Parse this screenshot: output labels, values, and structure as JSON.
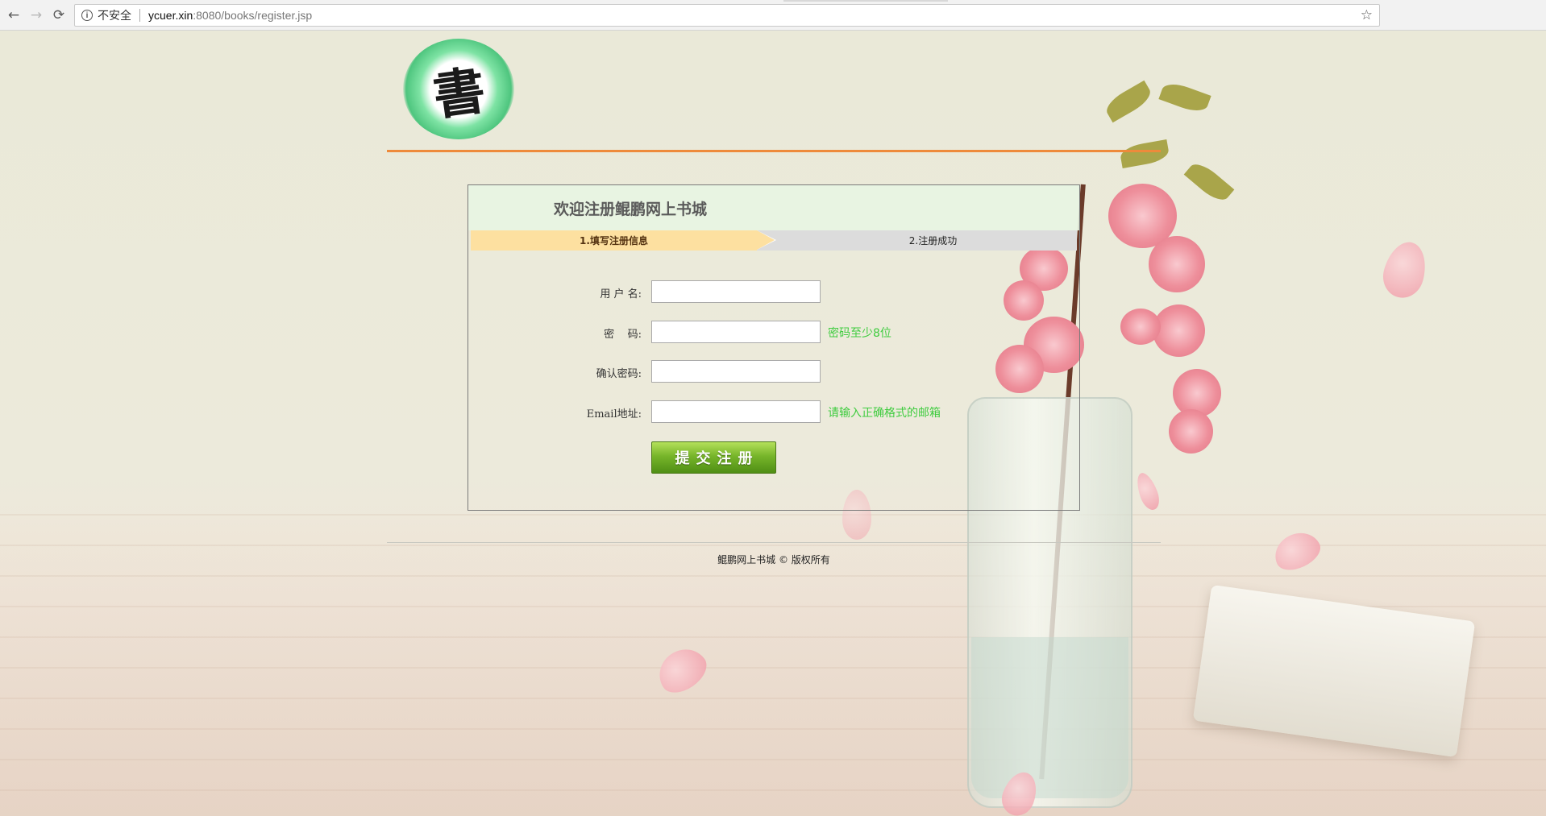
{
  "browser": {
    "security_label": "不安全",
    "url_host": "ycuer.xin",
    "url_rest": ":8080/books/register.jsp",
    "back_icon": "←",
    "forward_icon": "→",
    "reload_icon": "⟳",
    "info_icon": "i",
    "bookmark_icon": "☆"
  },
  "logo": {
    "glyph": "書"
  },
  "register": {
    "title": "欢迎注册鲲鹏网上书城",
    "steps": [
      {
        "label": "1.填写注册信息"
      },
      {
        "label": "2.注册成功"
      }
    ],
    "fields": {
      "username": {
        "label": "用 户 名:",
        "value": ""
      },
      "password": {
        "label": "密    码:",
        "value": "",
        "hint": "密码至少8位"
      },
      "confirm_password": {
        "label": "确认密码:",
        "value": ""
      },
      "email": {
        "label": "Email地址:",
        "value": "",
        "hint": "请输入正确格式的邮箱"
      }
    },
    "submit_label": "提交注册"
  },
  "footer": {
    "text": "鲲鹏网上书城 © 版权所有"
  },
  "colors": {
    "accent_orange": "#ee8a3b",
    "step_active": "#fde0a0",
    "step_inactive": "#dcdcdc",
    "hint_green": "#3fcc3f",
    "button_green": "#77b52a"
  }
}
